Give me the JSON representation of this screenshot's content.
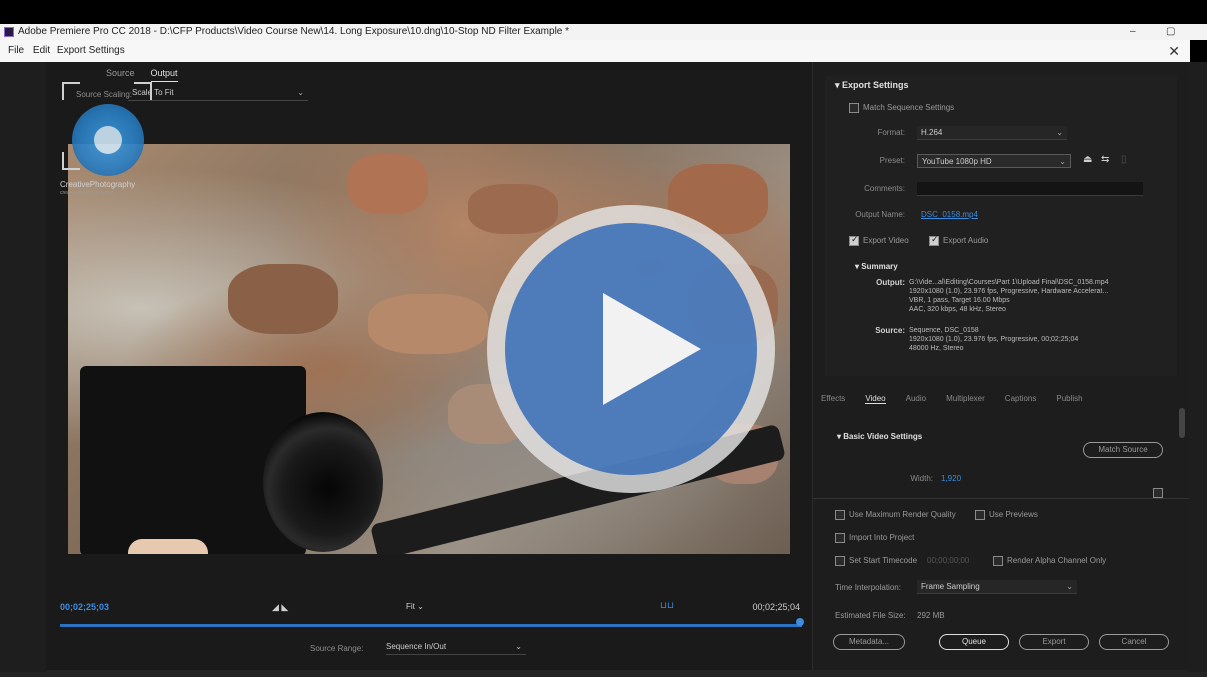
{
  "app": {
    "title": "Adobe Premiere Pro CC 2018 - D:\\CFP Products\\Video Course New\\14. Long Exposure\\10.dng\\10-Stop ND Filter Example *",
    "menu_file": "File",
    "menu_edit": "Edit",
    "minimize": "–",
    "restore": "▢"
  },
  "dialog": {
    "title": "Export Settings",
    "close": "✕"
  },
  "logo": {
    "text": "CreativePhotography",
    "subtext": "creativephotography.net"
  },
  "left_panel": {
    "tabs": [
      "Source",
      "Output"
    ],
    "active_tab": "Output",
    "source_scaling_label": "Source Scaling:",
    "source_scaling_value": "Scale To Fit",
    "timecode_in": "00;02;25;03",
    "timecode_out": "00;02;25;04",
    "fit_value": "Fit",
    "source_range_label": "Source Range:",
    "source_range_value": "Sequence In/Out"
  },
  "export_settings": {
    "section_title": "Export Settings",
    "match_sequence_label": "Match Sequence Settings",
    "format_label": "Format:",
    "format_value": "H.264",
    "preset_label": "Preset:",
    "preset_value": "YouTube 1080p HD",
    "comments_label": "Comments:",
    "comments_value": "",
    "output_name_label": "Output Name:",
    "output_name_value": "DSC_0158.mp4",
    "export_video_label": "Export Video",
    "export_audio_label": "Export Audio",
    "summary_title": "Summary",
    "output_label": "Output:",
    "output_lines": [
      "G:\\Vide...al\\Editing\\Courses\\Part 1\\Upload Final\\DSC_0158.mp4",
      "1920x1080 (1.0), 23.976 fps, Progressive, Hardware Accelerat...",
      "VBR, 1 pass, Target 16.00 Mbps",
      "AAC, 320 kbps, 48 kHz, Stereo"
    ],
    "source_label": "Source:",
    "source_lines": [
      "Sequence, DSC_0158",
      "1920x1080 (1.0), 23.976 fps, Progressive, 00;02;25;04",
      "48000 Hz, Stereo"
    ]
  },
  "sub_tabs": [
    "Effects",
    "Video",
    "Audio",
    "Multiplexer",
    "Captions",
    "Publish"
  ],
  "active_sub_tab": "Video",
  "video_settings": {
    "section_title": "Basic Video Settings",
    "match_source_label": "Match Source",
    "width_label": "Width:",
    "width_value": "1,920"
  },
  "options": {
    "max_render_quality": "Use Maximum Render Quality",
    "use_previews": "Use Previews",
    "import_into_project": "Import Into Project",
    "set_start_timecode": "Set Start Timecode",
    "start_timecode_value": "00;00;00;00",
    "render_alpha": "Render Alpha Channel Only",
    "time_interp_label": "Time Interpolation:",
    "time_interp_value": "Frame Sampling",
    "file_size_label": "Estimated File Size:",
    "file_size_value": "292 MB"
  },
  "buttons": {
    "metadata": "Metadata...",
    "queue": "Queue",
    "export": "Export",
    "cancel": "Cancel"
  }
}
